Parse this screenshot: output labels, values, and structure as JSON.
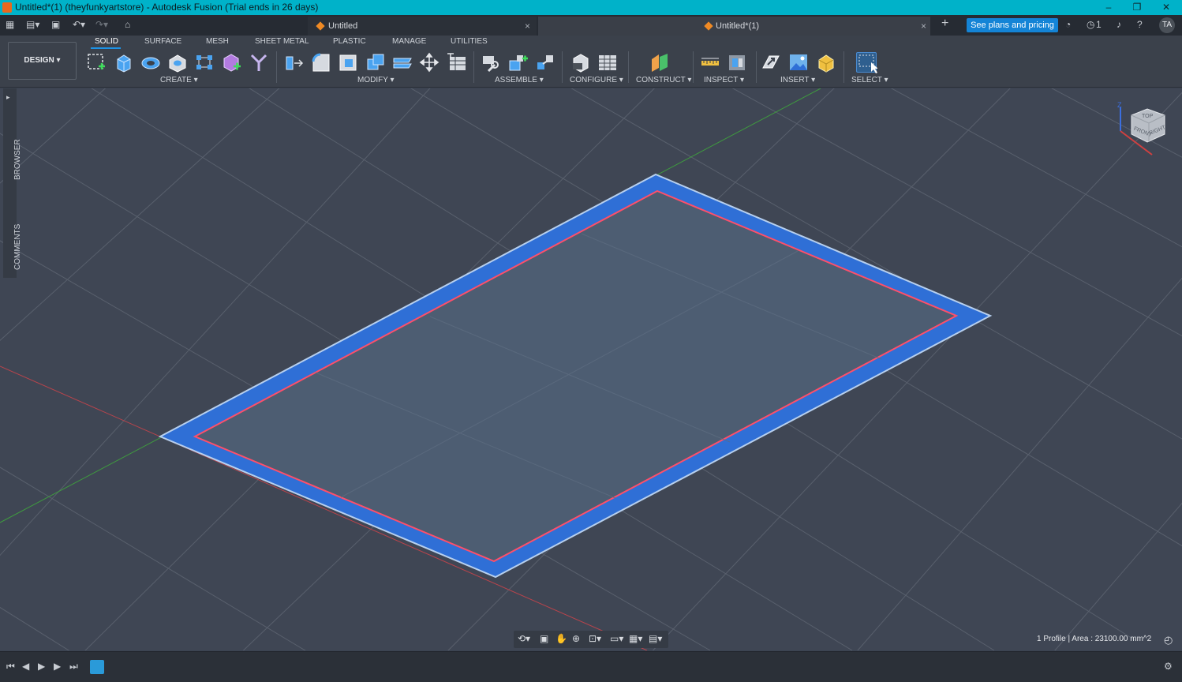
{
  "window": {
    "title": "Untitled*(1) (theyfunkyartstore) - Autodesk Fusion (Trial ends in 26 days)",
    "controls": [
      "–",
      "❐",
      "✕"
    ]
  },
  "tabs": {
    "items": [
      {
        "label": "Untitled",
        "active": false
      },
      {
        "label": "Untitled*(1)",
        "active": true
      }
    ],
    "close": "×",
    "new_tab": "+",
    "plans_button": "See plans and pricing",
    "jobs_count": "1",
    "user_initials": "TA"
  },
  "toolbar": {
    "mode_button": "DESIGN ▾",
    "workspace_tabs": [
      "SOLID",
      "SURFACE",
      "MESH",
      "SHEET METAL",
      "PLASTIC",
      "MANAGE",
      "UTILITIES"
    ],
    "active_workspace": "SOLID",
    "groups": [
      {
        "label": "CREATE ▾",
        "tools": [
          "new-sketch",
          "extrude",
          "revolve",
          "hole",
          "rectangular-pattern",
          "new-component",
          "create-form"
        ]
      },
      {
        "label": "MODIFY ▾",
        "tools": [
          "press-pull",
          "fillet",
          "shell",
          "combine",
          "offset-face",
          "move",
          "table"
        ]
      },
      {
        "label": "ASSEMBLE ▾",
        "tools": [
          "joint",
          "as-built-joint",
          "rigid-group"
        ]
      },
      {
        "label": "CONFIGURE ▾",
        "tools": [
          "configure",
          "configuration-table"
        ]
      },
      {
        "label": "CONSTRUCT ▾",
        "tools": [
          "offset-plane"
        ]
      },
      {
        "label": "INSPECT ▾",
        "tools": [
          "measure",
          "section-analysis"
        ]
      },
      {
        "label": "INSERT ▾",
        "tools": [
          "insert-derive",
          "decal",
          "insert-mesh"
        ]
      },
      {
        "label": "SELECT ▾",
        "tools": [
          "select"
        ]
      }
    ]
  },
  "side_panel": {
    "browser": "BROWSER",
    "comments": "COMMENTS"
  },
  "viewcube": {
    "faces": [
      "FRONT",
      "RIGHT",
      "TOP"
    ],
    "axis_label": "Z"
  },
  "status_bar": {
    "text": "1 Profile | Area : 23100.00 mm^2"
  },
  "colors": {
    "title_bar": "#00b2c9",
    "profile_fill": "#2f6fd6",
    "profile_inner": "#4d5d72",
    "sketch_line": "#ff4f6a",
    "accent": "#1484d6"
  }
}
